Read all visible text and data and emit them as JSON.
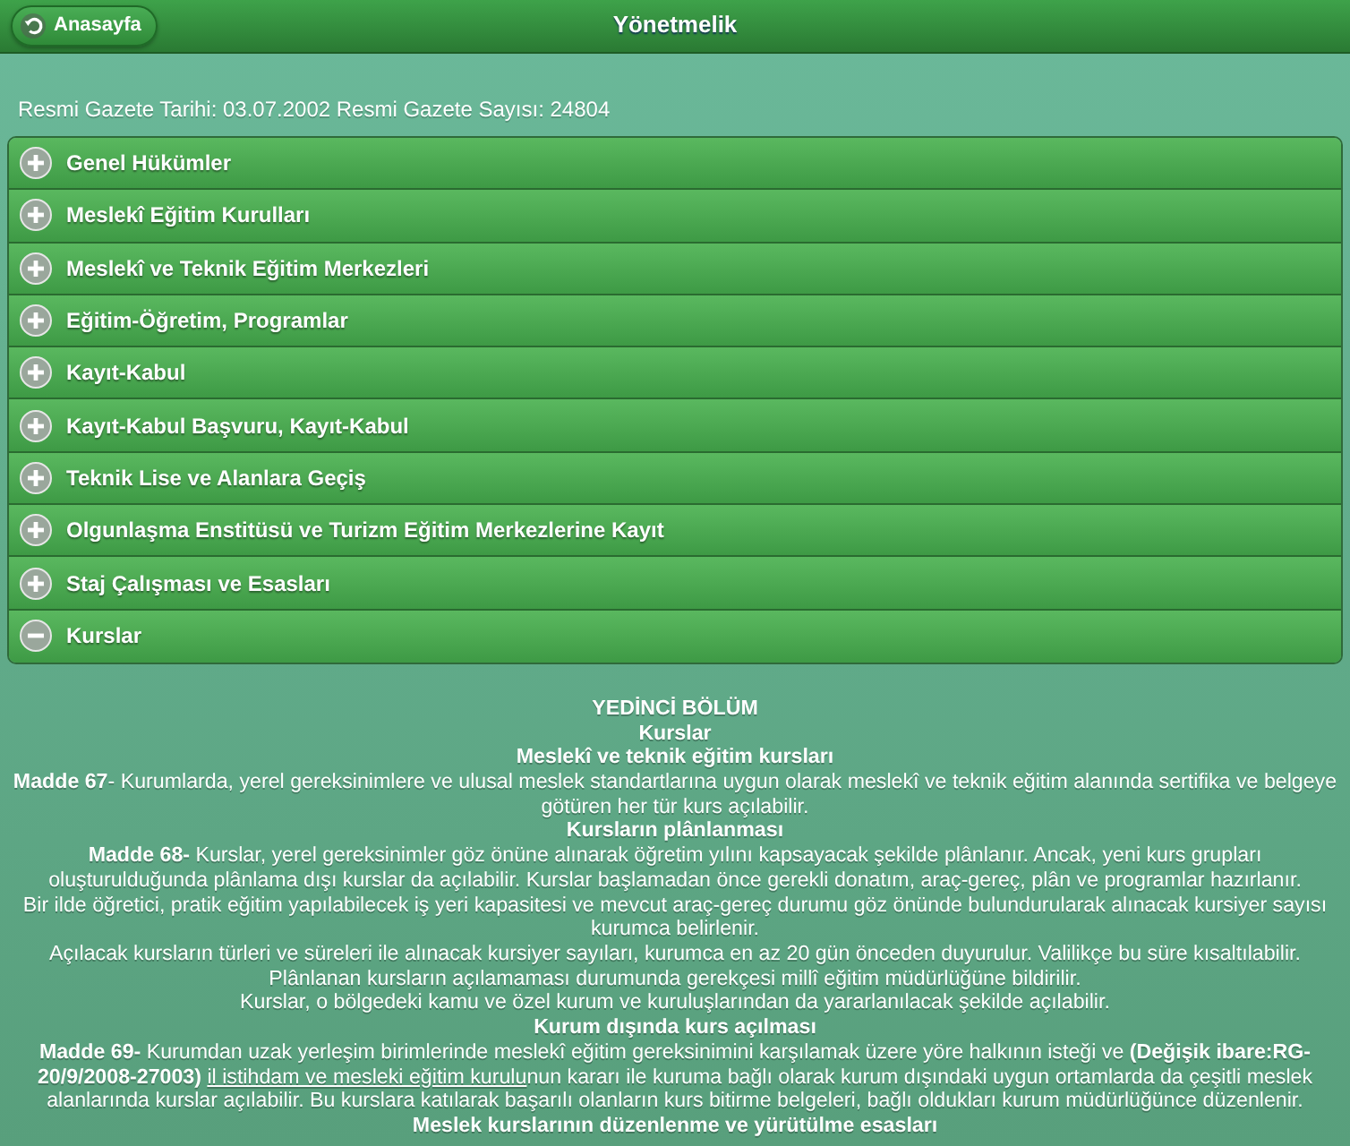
{
  "header": {
    "back_button": "Anasayfa",
    "title": "Yönetmelik"
  },
  "gazette_info": "Resmi Gazete Tarihi: 03.07.2002 Resmi Gazete Sayısı: 24804",
  "sections": [
    {
      "label": "Genel Hükümler",
      "expanded": false
    },
    {
      "label": "Meslekî Eğitim Kurulları",
      "expanded": false
    },
    {
      "label": "Meslekî ve Teknik Eğitim Merkezleri",
      "expanded": false
    },
    {
      "label": "Eğitim-Öğretim, Programlar",
      "expanded": false
    },
    {
      "label": "Kayıt-Kabul",
      "expanded": false
    },
    {
      "label": "Kayıt-Kabul Başvuru, Kayıt-Kabul",
      "expanded": false
    },
    {
      "label": "Teknik Lise ve Alanlara Geçiş",
      "expanded": false
    },
    {
      "label": "Olgunlaşma Enstitüsü ve Turizm Eğitim Merkezlerine Kayıt",
      "expanded": false
    },
    {
      "label": "Staj Çalışması ve Esasları",
      "expanded": false
    },
    {
      "label": "Kurslar",
      "expanded": true
    }
  ],
  "content": [
    {
      "kind": "heading",
      "text": "YEDİNCİ BÖLÜM"
    },
    {
      "kind": "heading",
      "text": "Kurslar"
    },
    {
      "kind": "heading",
      "text": "Meslekî ve teknik eğitim kursları"
    },
    {
      "kind": "paragraph",
      "parts": [
        {
          "kind": "bold",
          "text": "Madde 67"
        },
        {
          "kind": "plain",
          "text": "- Kurumlarda, yerel gereksinimlere ve ulusal meslek standartlarına uygun olarak meslekî ve teknik eğitim alanında sertifika ve belgeye götüren her tür kurs açılabilir."
        }
      ]
    },
    {
      "kind": "heading",
      "text": "Kursların plânlanması"
    },
    {
      "kind": "paragraph",
      "parts": [
        {
          "kind": "bold",
          "text": "Madde 68-"
        },
        {
          "kind": "plain",
          "text": " Kurslar, yerel gereksinimler göz önüne alınarak öğretim yılını kapsayacak şekilde plânlanır. Ancak, yeni kurs grupları oluşturulduğunda plânlama dışı kurslar da açılabilir. Kurslar başlamadan önce gerekli donatım, araç-gereç, plân ve programlar hazırlanır."
        }
      ]
    },
    {
      "kind": "paragraph",
      "parts": [
        {
          "kind": "plain",
          "text": "Bir ilde öğretici, pratik eğitim yapılabilecek iş yeri kapasitesi ve mevcut araç-gereç durumu göz önünde bulundurularak alınacak kursiyer sayısı kurumca belirlenir."
        }
      ]
    },
    {
      "kind": "paragraph",
      "parts": [
        {
          "kind": "plain",
          "text": "Açılacak kursların türleri ve süreleri ile alınacak kursiyer sayıları, kurumca en az 20 gün önceden duyurulur. Valilikçe bu süre kısaltılabilir."
        }
      ]
    },
    {
      "kind": "paragraph",
      "parts": [
        {
          "kind": "plain",
          "text": "Plânlanan kursların açılamaması durumunda gerekçesi millî eğitim müdürlüğüne bildirilir."
        }
      ]
    },
    {
      "kind": "paragraph",
      "parts": [
        {
          "kind": "plain",
          "text": "Kurslar, o bölgedeki kamu ve özel kurum ve kuruluşlarından da yararlanılacak şekilde açılabilir."
        }
      ]
    },
    {
      "kind": "heading",
      "text": "Kurum dışında kurs açılması"
    },
    {
      "kind": "paragraph",
      "parts": [
        {
          "kind": "bold",
          "text": "Madde 69-"
        },
        {
          "kind": "plain",
          "text": " Kurumdan uzak yerleşim birimlerinde meslekî eğitim gereksinimini karşılamak üzere yöre halkının isteği ve "
        },
        {
          "kind": "bold",
          "text": "(Değişik ibare:RG-20/9/2008-27003) "
        },
        {
          "kind": "link",
          "text": "il istihdam ve mesleki eğitim kurulu"
        },
        {
          "kind": "plain",
          "text": "nun kararı ile kuruma bağlı olarak kurum dışındaki uygun ortamlarda da çeşitli meslek alanlarında kurslar açılabilir. Bu kurslara katılarak başarılı olanların kurs bitirme belgeleri, bağlı oldukları kurum müdürlüğünce düzenlenir."
        }
      ]
    },
    {
      "kind": "heading",
      "text": "Meslek kurslarının düzenlenme ve yürütülme esasları"
    }
  ]
}
